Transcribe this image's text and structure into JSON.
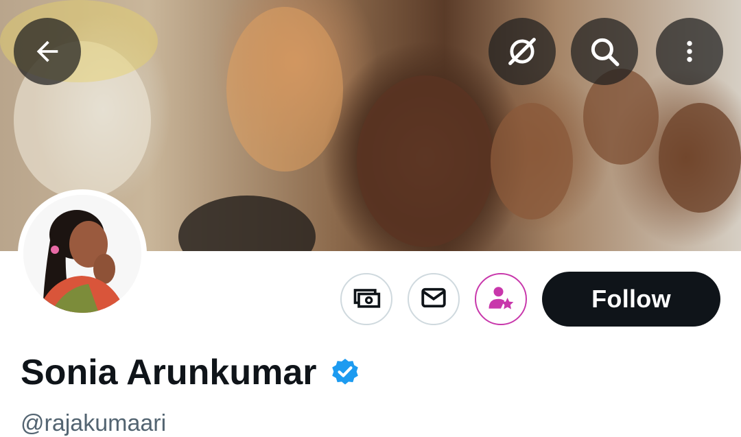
{
  "profile": {
    "display_name": "Sonia Arunkumar",
    "handle": "@rajakumaari",
    "verified": true
  },
  "actions": {
    "follow_label": "Follow"
  },
  "icons": {
    "back": "arrow-left-icon",
    "grok": "grok-icon",
    "search": "search-icon",
    "more": "more-vertical-icon",
    "tip": "money-icon",
    "message": "envelope-icon",
    "subscribe": "person-star-icon",
    "verified": "verified-badge-icon"
  },
  "colors": {
    "follow_bg": "#0f1419",
    "verified_blue": "#1d9bf0",
    "subscribe_accent": "#c837ab",
    "handle_gray": "#536471"
  }
}
